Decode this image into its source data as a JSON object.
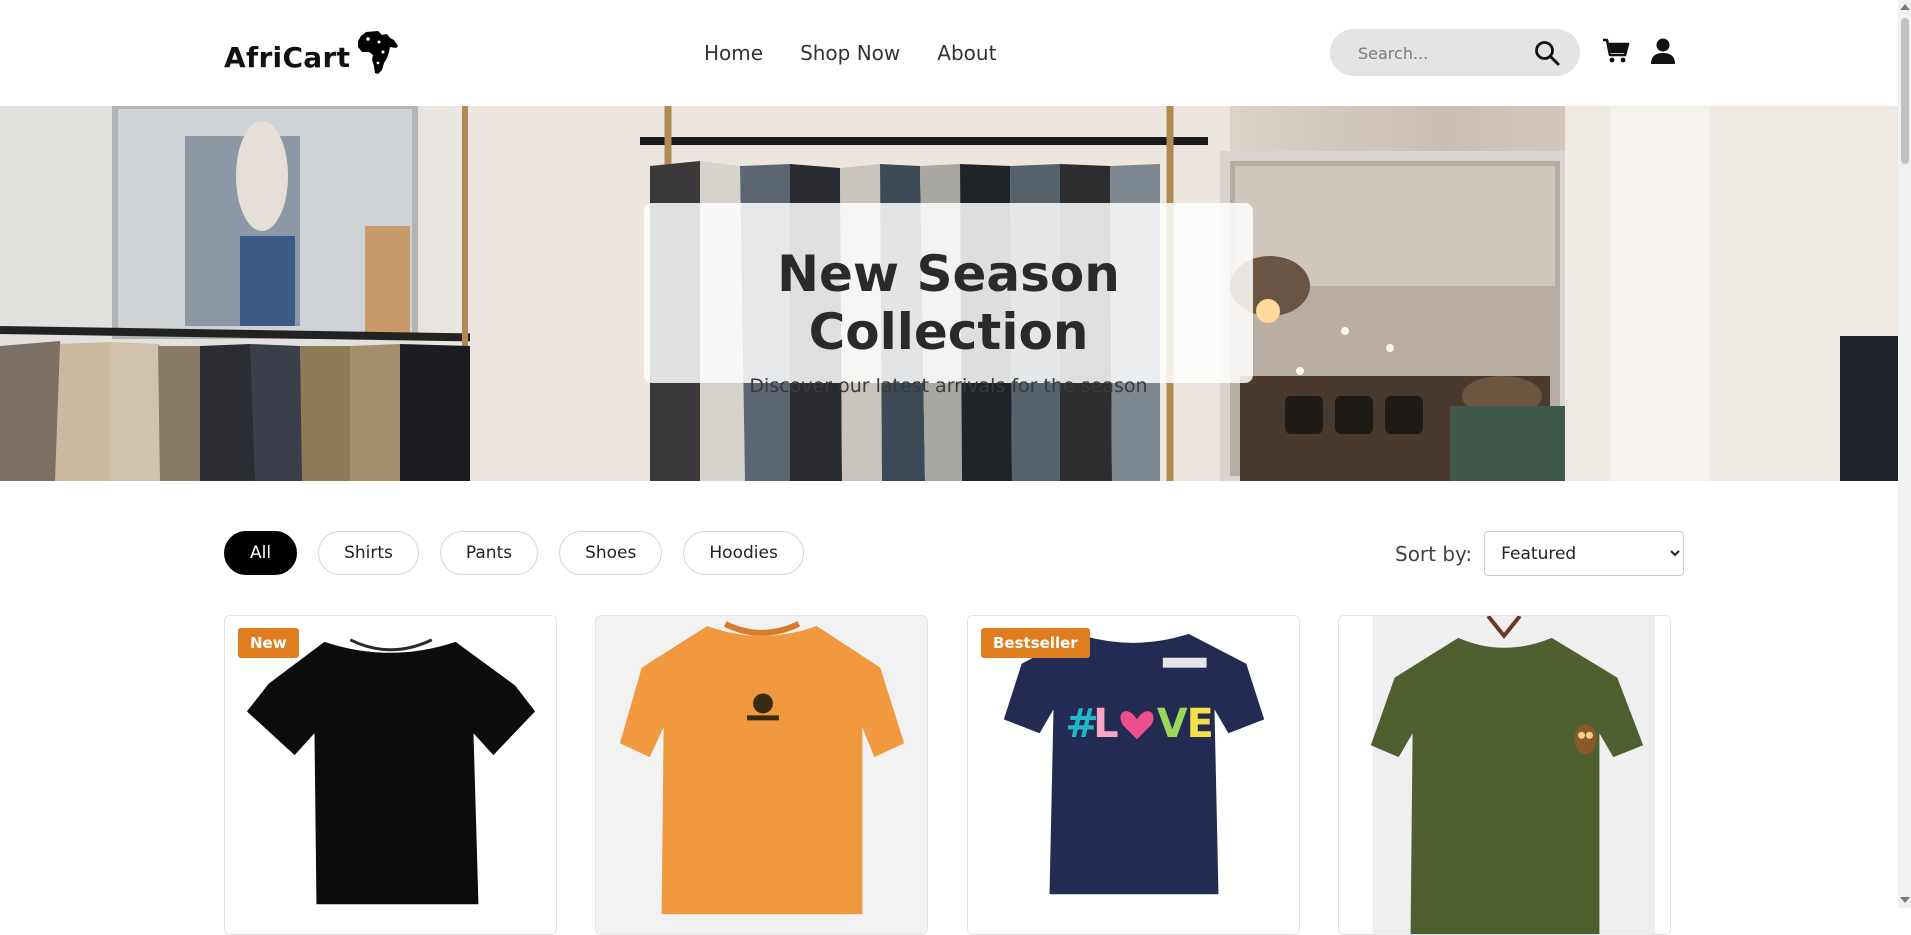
{
  "brand": {
    "name": "AfriCart"
  },
  "nav": {
    "items": [
      "Home",
      "Shop Now",
      "About"
    ]
  },
  "search": {
    "placeholder": "Search..."
  },
  "hero": {
    "title": "New Season Collection",
    "subtitle": "Discover our latest arrivals for the season"
  },
  "filters": {
    "items": [
      "All",
      "Shirts",
      "Pants",
      "Shoes",
      "Hoodies"
    ],
    "active": "All"
  },
  "sort": {
    "label": "Sort by:",
    "selected": "Featured"
  },
  "products": [
    {
      "badge": "New",
      "color": "#111111",
      "image": "black-tshirt"
    },
    {
      "badge": "",
      "color": "#f09a4d",
      "image": "orange-tshirt"
    },
    {
      "badge": "Bestseller",
      "color": "#2a3358",
      "image": "navy-love-tshirt"
    },
    {
      "badge": "",
      "color": "#4a5a2c",
      "image": "olive-owl-tshirt"
    }
  ],
  "colors": {
    "accent": "#e07d1f",
    "active_chip": "#000000"
  }
}
